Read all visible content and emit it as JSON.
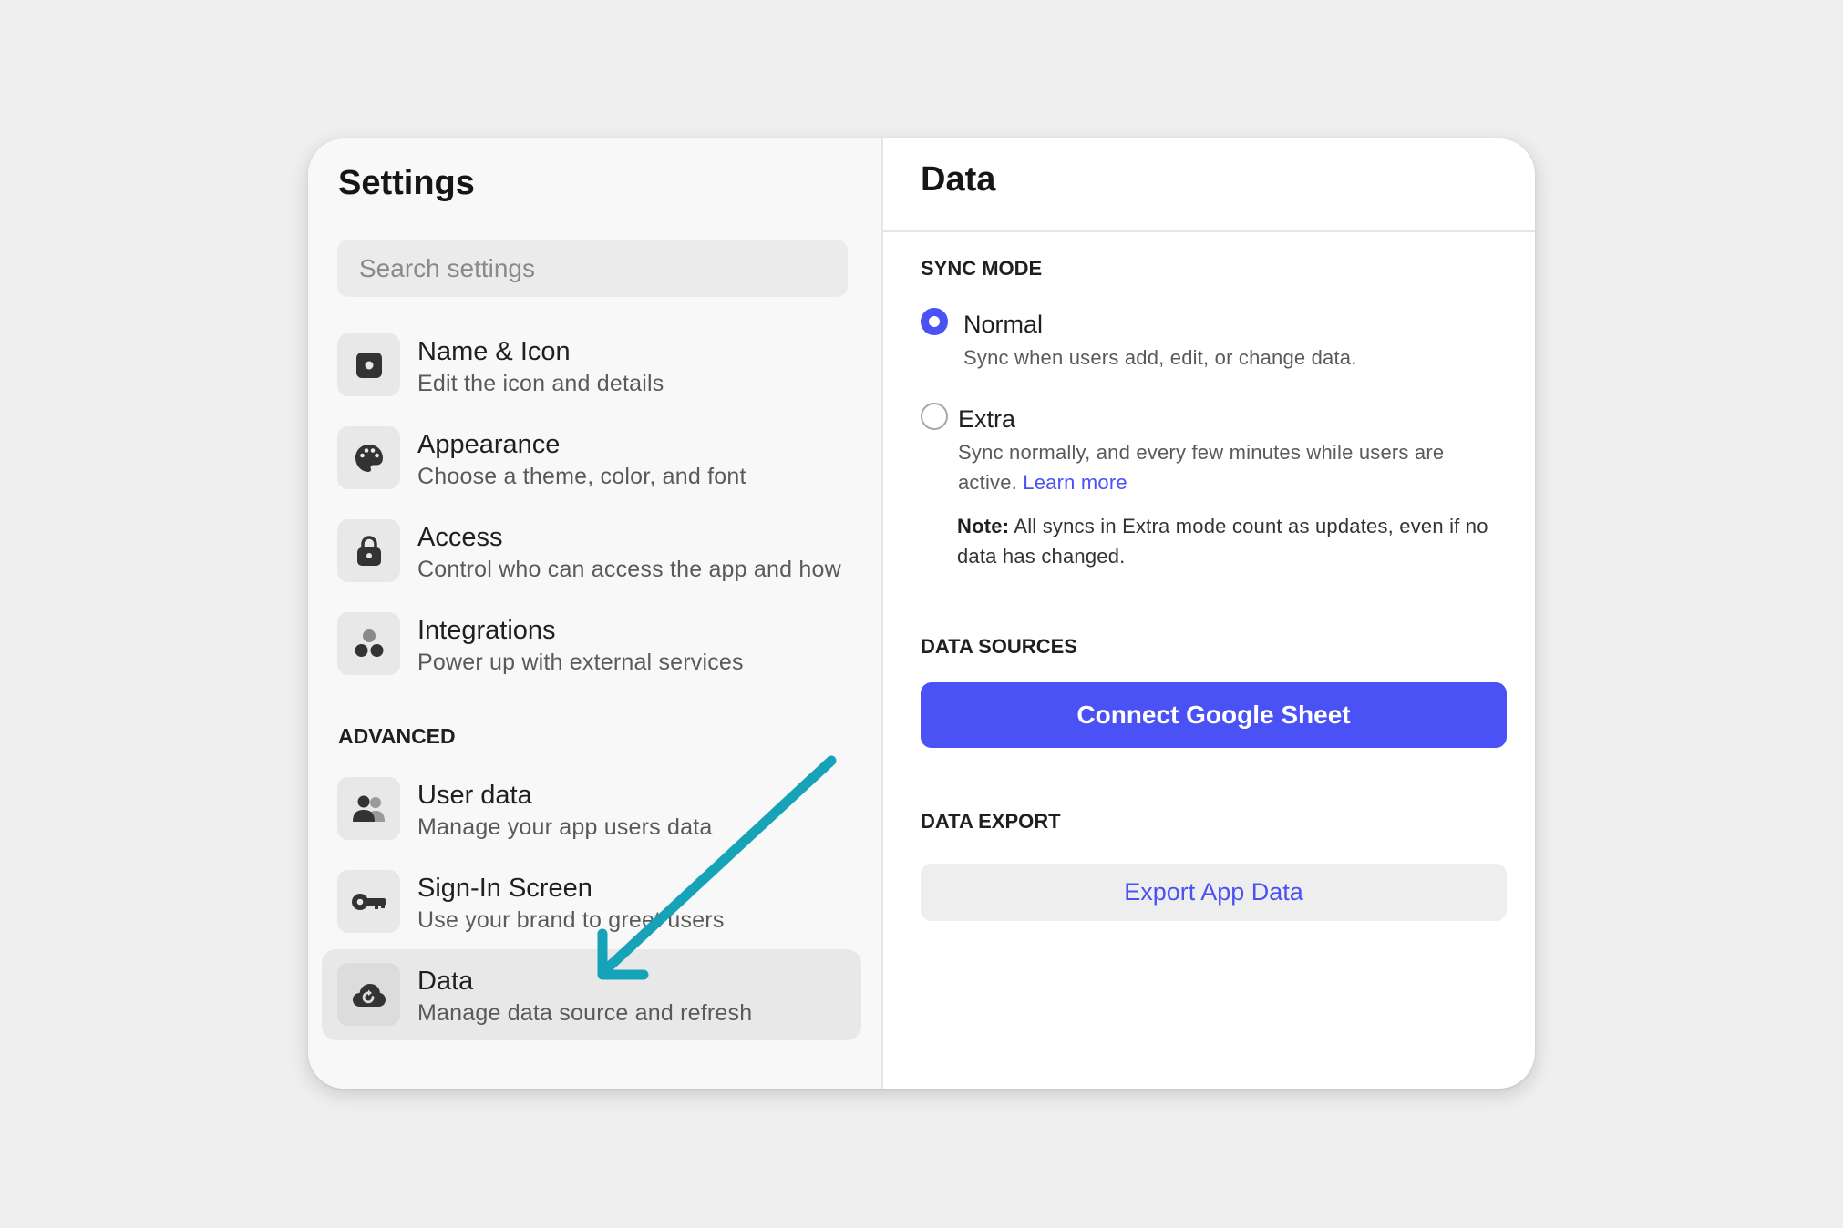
{
  "sidebar": {
    "title": "Settings",
    "search_placeholder": "Search settings",
    "items": [
      {
        "title": "Name & Icon",
        "subtitle": "Edit the icon and details",
        "icon": "square-icon"
      },
      {
        "title": "Appearance",
        "subtitle": "Choose a theme, color, and font",
        "icon": "palette-icon"
      },
      {
        "title": "Access",
        "subtitle": "Control who can access the app and how",
        "icon": "lock-icon"
      },
      {
        "title": "Integrations",
        "subtitle": "Power up with external services",
        "icon": "circles-icon"
      }
    ],
    "advanced_label": "ADVANCED",
    "advanced_items": [
      {
        "title": "User data",
        "subtitle": "Manage your app users data",
        "icon": "users-icon"
      },
      {
        "title": "Sign-In Screen",
        "subtitle": "Use your brand to greet users",
        "icon": "key-icon"
      },
      {
        "title": "Data",
        "subtitle": "Manage data source and refresh",
        "icon": "cloud-refresh-icon",
        "active": true
      }
    ]
  },
  "main": {
    "title": "Data",
    "sync_mode_label": "SYNC MODE",
    "options": [
      {
        "title": "Normal",
        "description": "Sync when users add, edit, or change data.",
        "selected": true
      },
      {
        "title": "Extra",
        "description": "Sync normally, and every few minutes while users are active.",
        "link": "Learn more",
        "selected": false
      }
    ],
    "note_label": "Note:",
    "note_text": "All syncs in Extra mode count as updates, even if no data has changed.",
    "data_sources_label": "DATA SOURCES",
    "connect_button": "Connect Google Sheet",
    "data_export_label": "DATA EXPORT",
    "export_button": "Export App Data"
  },
  "colors": {
    "accent": "#4a51f5",
    "annotation_arrow": "#16a3b8"
  }
}
